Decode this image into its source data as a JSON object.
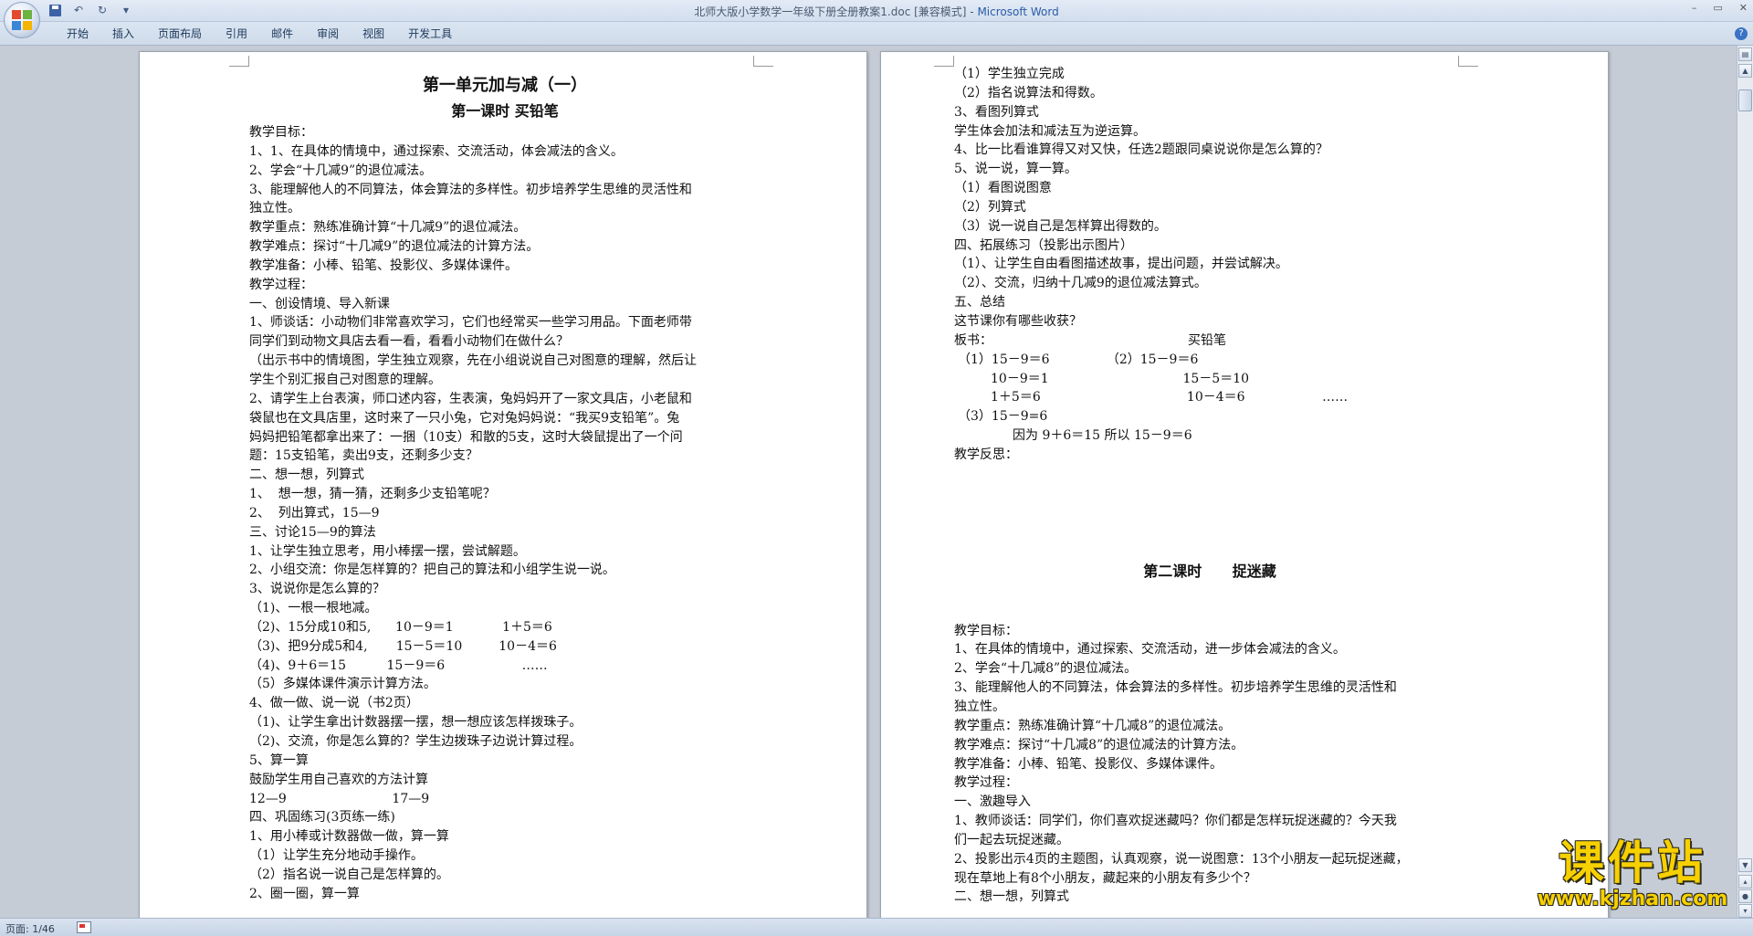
{
  "window": {
    "title_doc": "北师大版小学数学一年级下册全册教案1.doc [兼容模式] - ",
    "title_app": "Microsoft Word",
    "controls": [
      "–",
      "▭",
      "✕"
    ]
  },
  "ribbon": {
    "tabs": [
      "开始",
      "插入",
      "页面布局",
      "引用",
      "邮件",
      "审阅",
      "视图",
      "开发工具"
    ],
    "help": "?"
  },
  "status": {
    "page": "页面: 1/46"
  },
  "watermark": {
    "main": "课件站",
    "url": "www.kjzhan.com"
  },
  "left_page": {
    "title": "第一单元加与减（一）",
    "subtitle": "第一课时 买铅笔",
    "lines": [
      "教学目标：",
      "1、1、在具体的情境中，通过探索、交流活动，体会减法的含义。",
      "2、学会“十几减9”的退位减法。",
      "3、能理解他人的不同算法，体会算法的多样性。初步培养学生思维的灵活性和",
      "独立性。",
      "教学重点：熟练准确计算“十几减9”的退位减法。",
      "教学难点：探讨“十几减9”的退位减法的计算方法。",
      "教学准备：小棒、铅笔、投影仪、多媒体课件。",
      "教学过程：",
      "一、创设情境、导入新课",
      "1、师谈话：小动物们非常喜欢学习，它们也经常买一些学习用品。下面老师带",
      "同学们到动物文具店去看一看，看看小动物们在做什么？",
      "（出示书中的情境图，学生独立观察，先在小组说说自己对图意的理解，然后让",
      "学生个别汇报自己对图意的理解。",
      "2、请学生上台表演，师口述内容，生表演，兔妈妈开了一家文具店，小老鼠和",
      "袋鼠也在文具店里，这时来了一只小兔，它对兔妈妈说：“我买9支铅笔”。兔",
      "妈妈把铅笔都拿出来了：一捆（10支）和散的5支，这时大袋鼠提出了一个问",
      "题：15支铅笔，卖出9支，还剩多少支？",
      "二、想一想，列算式",
      "1、  想一想，猜一猜，还剩多少支铅笔呢？",
      "2、  列出算式，15—9",
      "三、讨论15—9的算法",
      "1、让学生独立思考，用小棒摆一摆，尝试解题。",
      "2、小组交流：你是怎样算的？把自己的算法和小组学生说一说。",
      "3、说说你是怎么算的？",
      "（1)、一根一根地减。",
      "（2)、15分成10和5,      10－9＝1            1＋5＝6",
      "（3)、把9分成5和4,       15－5＝10         10－4＝6",
      "（4)、9＋6＝15          15－9＝6                   ……",
      "（5）多媒体课件演示计算方法。",
      "4、做一做、说一说（书2页）",
      "（1)、让学生拿出计数器摆一摆，想一想应该怎样拨珠子。",
      "（2)、交流，你是怎么算的？学生边拨珠子边说计算过程。",
      "5、算一算",
      "鼓励学生用自己喜欢的方法计算",
      "12—9                          17—9",
      "四、巩固练习(3页练一练)",
      "1、用小棒或计数器做一做，算一算",
      "（1）让学生充分地动手操作。",
      "（2）指名说一说自己是怎样算的。",
      "2、圈一圈，算一算"
    ]
  },
  "right_page": {
    "lines_top": [
      "（1）学生独立完成",
      "（2）指名说算法和得数。",
      "3、看图列算式",
      "学生体会加法和减法互为逆运算。",
      "4、比一比看谁算得又对又快，任选2题跟同桌说说你是怎么算的？",
      "5、说一说，算一算。",
      "（1）看图说图意",
      "（2）列算式",
      "（3）说一说自己是怎样算出得数的。",
      "四、拓展练习（投影出示图片）",
      "（1）、让学生自由看图描述故事，提出问题，并尝试解决。",
      "（2）、交流，归纳十几减9的退位减法算式。",
      "五、总结",
      "这节课你有哪些收获？"
    ],
    "board_label": "板书：",
    "board_title": "买铅笔",
    "board_rows": [
      "（1）15－9＝6              （2）15－9＝6",
      "10－9＝1                                 15－5＝10",
      "1＋5＝6                                    10－4＝6                   ……",
      "（3）15－9=6",
      "因为 9＋6＝15 所以 15－9＝6"
    ],
    "reflection": "教学反思：",
    "lesson2_title": "第二课时      捉迷藏",
    "lines_bottom": [
      "教学目标：",
      "1、在具体的情境中，通过探索、交流活动，进一步体会减法的含义。",
      "2、学会“十几减8”的退位减法。",
      "3、能理解他人的不同算法，体会算法的多样性。初步培养学生思维的灵活性和",
      "独立性。",
      "教学重点：熟练准确计算“十几减8”的退位减法。",
      "教学难点：探讨“十几减8”的退位减法的计算方法。",
      "教学准备：小棒、铅笔、投影仪、多媒体课件。",
      "教学过程：",
      "一、激趣导入",
      "1、教师谈话：同学们，你们喜欢捉迷藏吗？你们都是怎样玩捉迷藏的？今天我",
      "们一起去玩捉迷藏。",
      "2、投影出示4页的主题图，认真观察，说一说图意：13个小朋友一起玩捉迷藏，",
      "现在草地上有8个小朋友，藏起来的小朋友有多少个？",
      "二、想一想，列算式"
    ]
  }
}
